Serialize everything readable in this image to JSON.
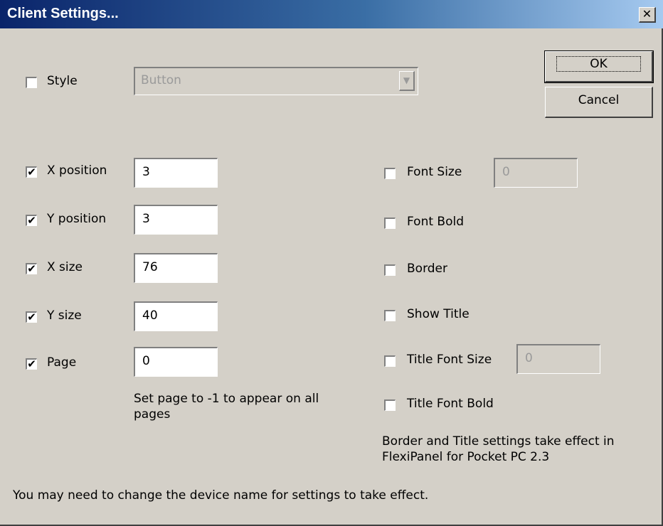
{
  "window": {
    "title": "Client Settings..."
  },
  "style": {
    "label": "Style",
    "checked": false,
    "combo_value": "Button"
  },
  "buttons": {
    "ok": "OK",
    "cancel": "Cancel"
  },
  "left_fields": [
    {
      "label": "X position",
      "checked": true,
      "value": "3"
    },
    {
      "label": "Y position",
      "checked": true,
      "value": "3"
    },
    {
      "label": "X size",
      "checked": true,
      "value": "76"
    },
    {
      "label": "Y size",
      "checked": true,
      "value": "40"
    },
    {
      "label": "Page",
      "checked": true,
      "value": "0"
    }
  ],
  "page_note": "Set page to -1 to appear on all pages",
  "right_options": [
    {
      "label": "Font Size",
      "checked": false,
      "value": "0"
    },
    {
      "label": "Font Bold",
      "checked": false
    },
    {
      "label": "Border",
      "checked": false
    },
    {
      "label": "Show Title",
      "checked": false
    },
    {
      "label": "Title Font Size",
      "checked": false,
      "value": "0"
    },
    {
      "label": "Title Font Bold",
      "checked": false
    }
  ],
  "border_note": "Border and Title settings take effect in FlexiPanel for Pocket PC 2.3",
  "footer_note": "You may need to change the device name for settings to take effect.",
  "check_glyph": "✔"
}
